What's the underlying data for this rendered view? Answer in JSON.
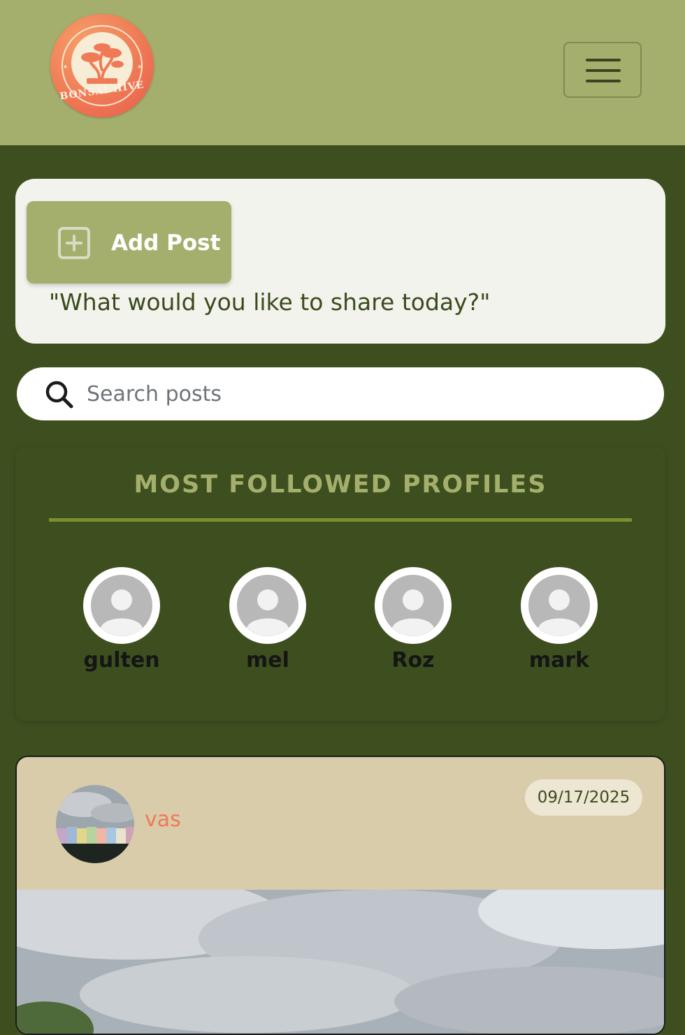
{
  "header": {
    "logo_text": "BONSAI HIVE"
  },
  "composer": {
    "add_post_label": "Add Post",
    "prompt": "\"What would you like to share today?\""
  },
  "search": {
    "placeholder": "Search posts",
    "value": ""
  },
  "profiles": {
    "title": "MOST FOLLOWED PROFILES",
    "items": [
      {
        "name": "gulten"
      },
      {
        "name": "mel"
      },
      {
        "name": "Roz"
      },
      {
        "name": "mark"
      }
    ]
  },
  "post": {
    "author": "vas",
    "date": "09/17/2025"
  },
  "colors": {
    "header_bg": "#a5af6d",
    "page_bg": "#3e4f1f",
    "accent": "#ef7a55",
    "card_bg": "#d8ccaa"
  }
}
